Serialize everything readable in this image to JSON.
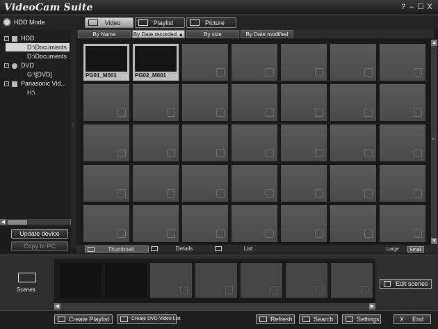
{
  "window": {
    "title": "VideoCam Suite",
    "controls": {
      "help": "?",
      "minimize": "–",
      "maximize": "☐",
      "close": "X"
    }
  },
  "mode": {
    "label": "HDD Mode",
    "tabs": [
      {
        "label": "Video",
        "icon": "film-icon",
        "active": true
      },
      {
        "label": "Playlist",
        "icon": "playlist-icon",
        "active": false
      },
      {
        "label": "Picture",
        "icon": "picture-icon",
        "active": false
      }
    ]
  },
  "tree": {
    "items": [
      {
        "label": "HDD",
        "icon": "hdd-icon",
        "expander": "−"
      },
      {
        "label": "D:\\Documents ...",
        "selected": true
      },
      {
        "label": "D:\\Documents ..."
      },
      {
        "label": "DVD",
        "icon": "disc-icon",
        "expander": "−"
      },
      {
        "label": "G:\\[DVD]"
      },
      {
        "label": "Panasonic Vid...",
        "icon": "camera-icon",
        "expander": "−"
      },
      {
        "label": "H:\\"
      }
    ]
  },
  "side_buttons": {
    "update_device": "Update device",
    "copy_to_pc": "Copy to PC"
  },
  "sort": {
    "tabs": [
      {
        "label": "By Name"
      },
      {
        "label": "By Date recorded ▲",
        "active": true
      },
      {
        "label": "By size"
      },
      {
        "label": "By Date modified"
      }
    ]
  },
  "clips": [
    {
      "name": "PG01_M001"
    },
    {
      "name": "PG02_M001"
    }
  ],
  "view": {
    "tabs": [
      {
        "label": "Thumbnail",
        "active": true
      },
      {
        "label": "Details"
      },
      {
        "label": "List"
      }
    ],
    "size_large": "Large",
    "size_small": "Small"
  },
  "scenes": {
    "label": "Scenes",
    "edit_button": "Edit scenes",
    "filled_count": 2
  },
  "bottom": {
    "create_playlist": "Create Playlist",
    "create_dvd_list": "Create DVD-Video List",
    "refresh": "Refresh",
    "search": "Search",
    "settings": "Settings",
    "end": "End",
    "end_icon": "X"
  },
  "colors": {
    "background": "#1c1c1c",
    "panel": "#2e2e2e",
    "active_tab": "#d4d4d4"
  }
}
